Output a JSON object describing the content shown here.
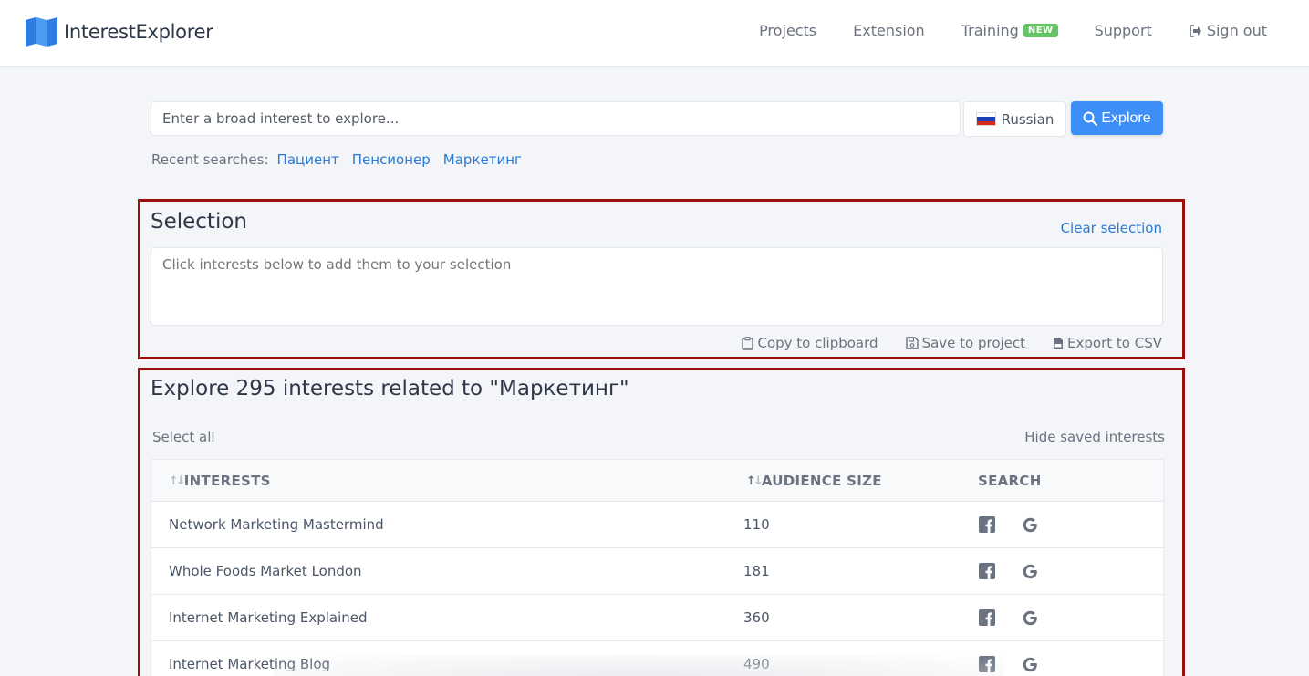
{
  "header": {
    "brand": "InterestExplorer",
    "nav": {
      "projects": "Projects",
      "extension": "Extension",
      "training": "Training",
      "training_badge": "NEW",
      "support": "Support",
      "signout": "Sign out"
    }
  },
  "search": {
    "placeholder": "Enter a broad interest to explore...",
    "language": "Russian",
    "explore_label": "Explore",
    "recent_label": "Recent searches:",
    "recent": [
      "Пациент",
      "Пенсионер",
      "Маркетинг"
    ]
  },
  "selection": {
    "title": "Selection",
    "clear_label": "Clear selection",
    "placeholder": "Click interests below to add them to your selection",
    "actions": {
      "copy": "Copy to clipboard",
      "save": "Save to project",
      "export": "Export to CSV"
    }
  },
  "explore": {
    "title": "Explore 295 interests related to \"Маркетинг\"",
    "select_all": "Select all",
    "hide_saved": "Hide saved interests",
    "columns": {
      "interests": "INTERESTS",
      "audience": "AUDIENCE SIZE",
      "search": "SEARCH"
    },
    "rows": [
      {
        "interest": "Network Marketing Mastermind",
        "audience": "110"
      },
      {
        "interest": "Whole Foods Market London",
        "audience": "181"
      },
      {
        "interest": "Internet Marketing Explained",
        "audience": "360"
      },
      {
        "interest": "Internet Marketing Blog",
        "audience": "490"
      }
    ]
  },
  "colors": {
    "accent": "#3d8ef6",
    "link": "#2a7ad4",
    "highlight_border": "#9b0f0f",
    "badge": "#62c462"
  }
}
